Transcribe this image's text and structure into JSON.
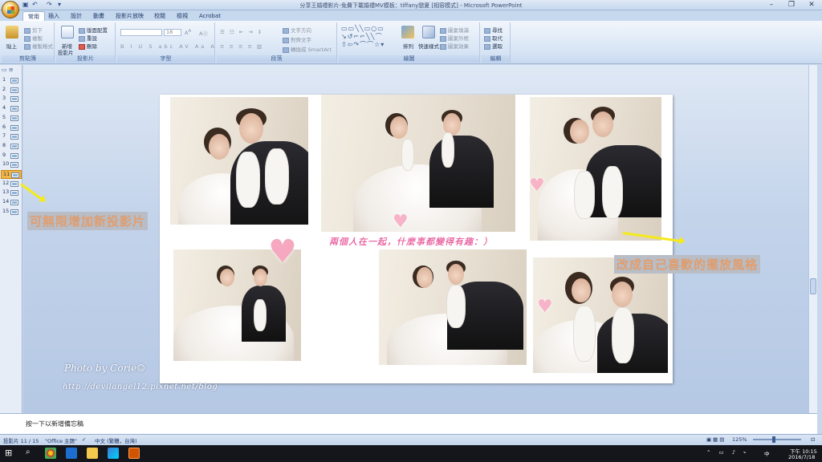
{
  "window": {
    "title": "分享王婚禮影片-免費下載婚禮MV模板：tiffany戀夏 [相容模式] - Microsoft PowerPoint",
    "controls": [
      "–",
      "❐",
      "✕"
    ]
  },
  "tabs": [
    {
      "label": "常用",
      "active": true
    },
    {
      "label": "插入"
    },
    {
      "label": "設計"
    },
    {
      "label": "動畫"
    },
    {
      "label": "投影片放映"
    },
    {
      "label": "校閱"
    },
    {
      "label": "檢視"
    },
    {
      "label": "Acrobat"
    }
  ],
  "ribbon": {
    "clipboard": {
      "label": "剪貼簿",
      "paste": "貼上",
      "cut": "剪下",
      "copy": "複製",
      "format_painter": "複製格式"
    },
    "slides": {
      "label": "投影片",
      "new_slide": "新增",
      "new_slide2": "投影片",
      "layout": "版面配置",
      "reset": "重設",
      "delete": "刪除"
    },
    "font": {
      "label": "字型",
      "size": "18"
    },
    "paragraph": {
      "label": "段落",
      "text_direction": "文字方向",
      "align_text": "對齊文字",
      "smartart": "轉換成 SmartArt"
    },
    "drawing": {
      "label": "繪圖",
      "arrange": "排列",
      "quick_styles": "快速樣式",
      "fill": "圖案填滿",
      "outline": "圖案外框",
      "effects": "圖案效果"
    },
    "editing": {
      "label": "編輯",
      "find": "尋找",
      "replace": "取代",
      "select": "選取"
    }
  },
  "thumbnails": {
    "items": [
      "1",
      "2",
      "3",
      "4",
      "5",
      "6",
      "7",
      "8",
      "9",
      "10",
      "11",
      "12",
      "13",
      "14",
      "15"
    ],
    "selected_index": 10
  },
  "slide": {
    "pink_text": "兩個人在一起，什麼事都變得有趣：）",
    "photo_by": "Photo by Corie☺",
    "url": "http://devilangel12.pixnet.net/blog"
  },
  "annotations": {
    "left_note": "可無限增加新投影片",
    "right_note": "改成自己喜歡的擺放風格"
  },
  "notes": {
    "placeholder": "按一下以新增備忘稿"
  },
  "status": {
    "slide_counter": "投影片 11 / 15",
    "theme": "\"Office 主題\"",
    "language": "中文 (繁體，台灣)",
    "zoom": "125%"
  },
  "taskbar": {
    "time": "下午 10:15",
    "date": "2016/7/18",
    "ime": "中"
  },
  "colors": {
    "accent": "#f5b641",
    "pink": "#f060a0",
    "note_text": "#f4a26b",
    "arrow": "#f5ea1a"
  }
}
